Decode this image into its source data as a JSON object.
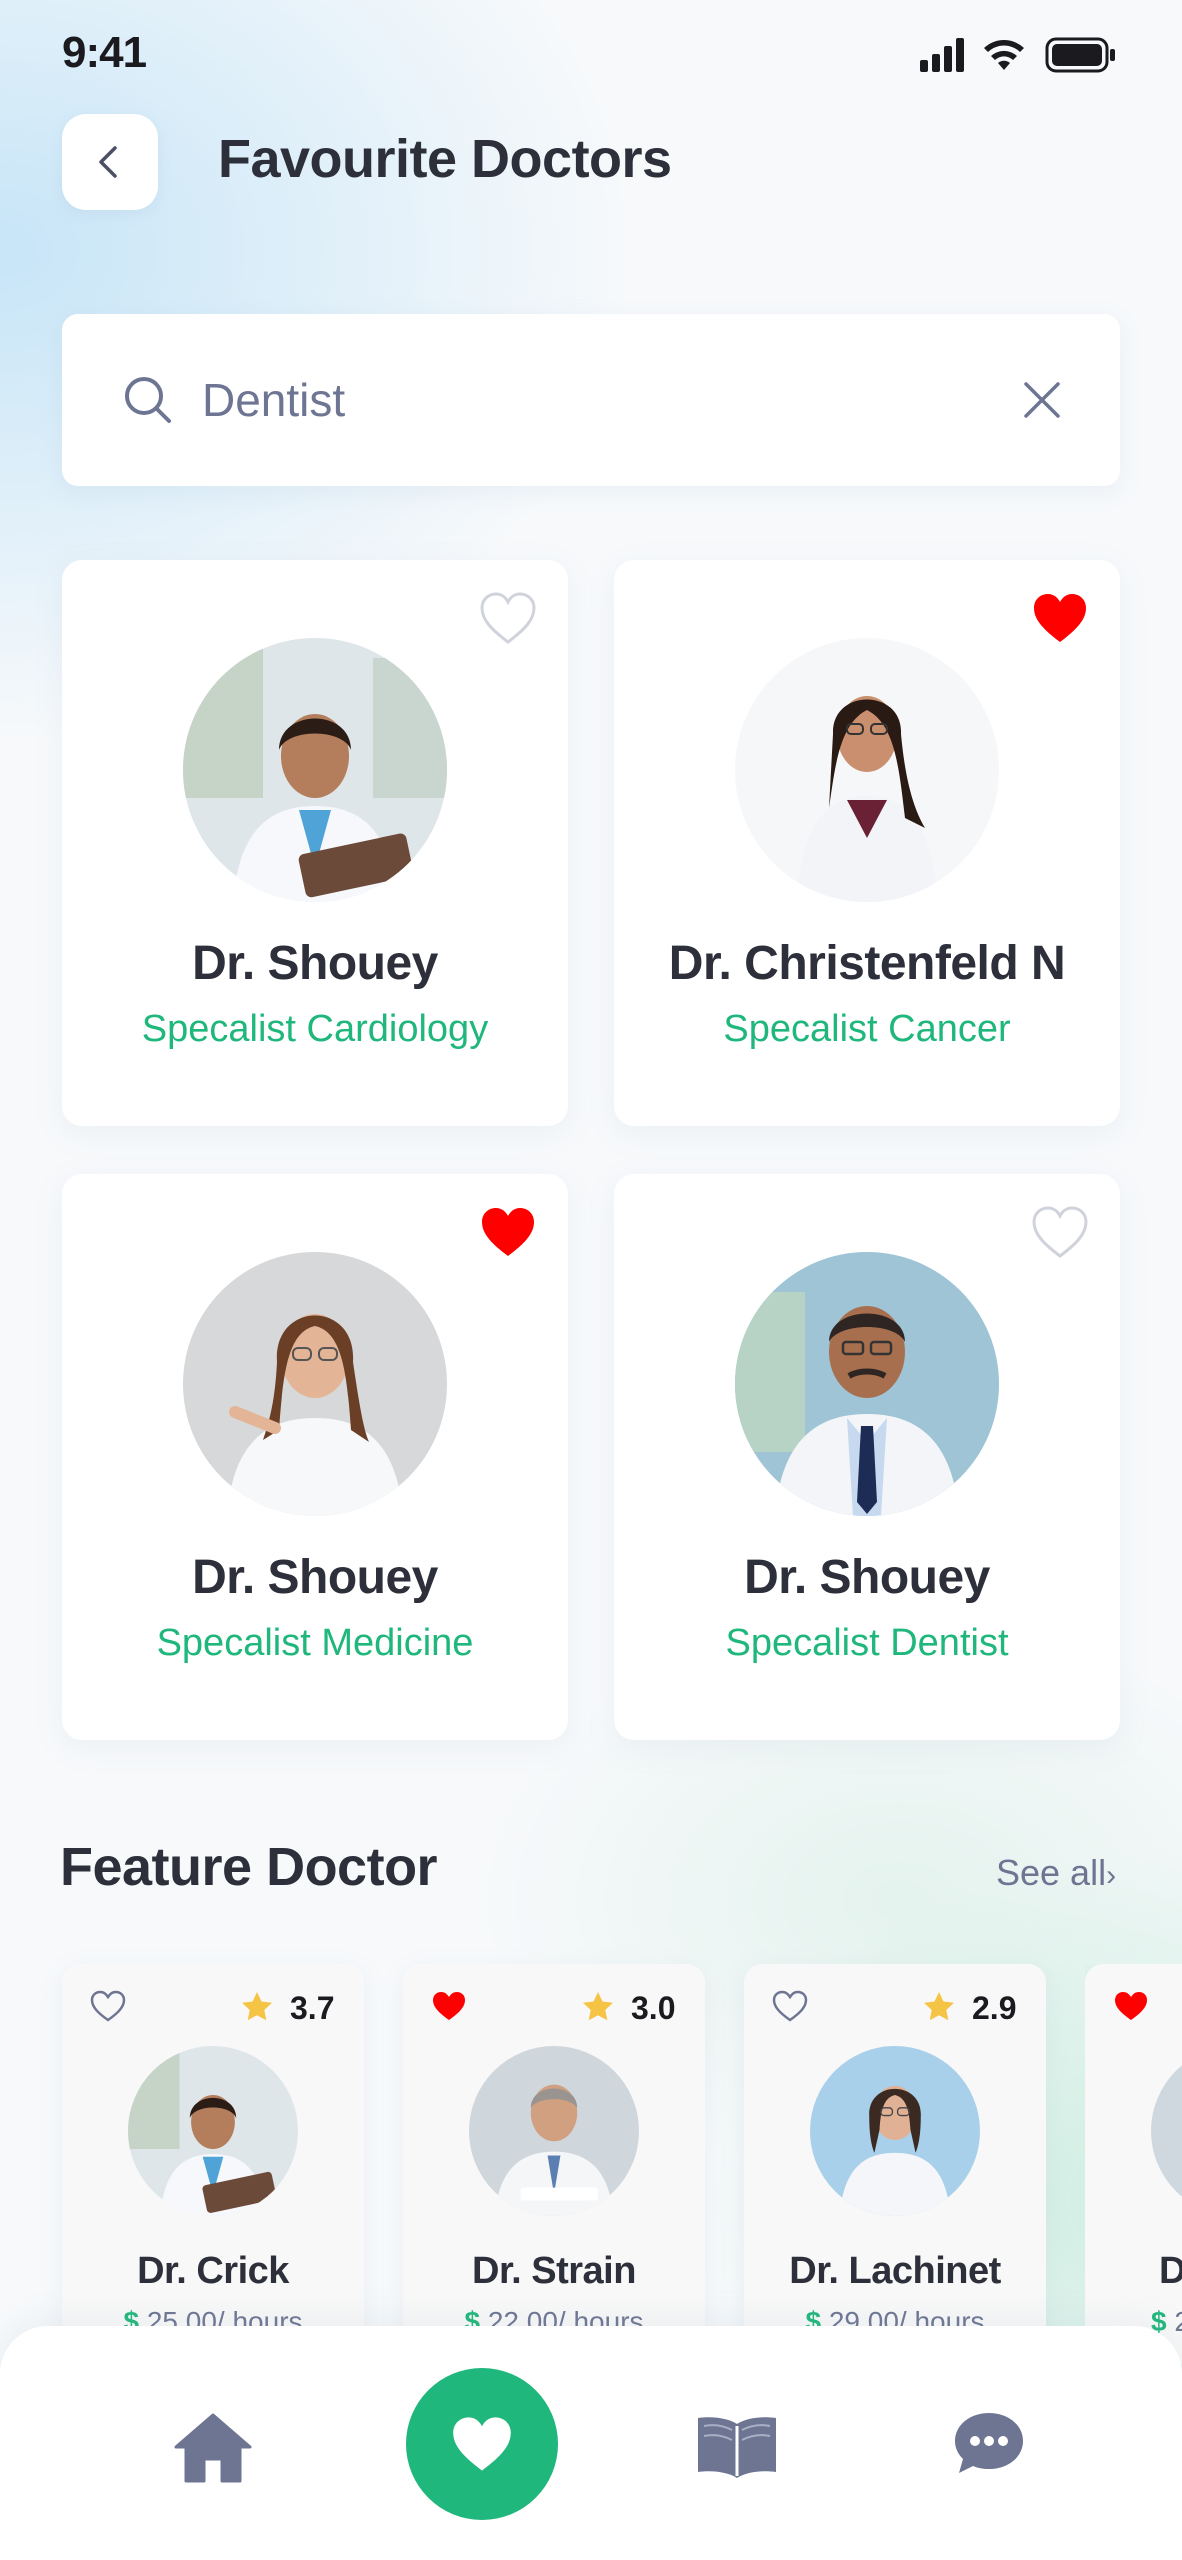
{
  "status_bar": {
    "time": "9:41",
    "icons": [
      "signal-icon",
      "wifi-icon",
      "battery-icon"
    ]
  },
  "header": {
    "back_icon": "chevron-left-icon",
    "title": "Favourite Doctors"
  },
  "search": {
    "value": "Dentist",
    "icon": "search-icon",
    "clear_icon": "close-icon"
  },
  "favourites": [
    {
      "name": "Dr. Shouey",
      "specialty": "Specalist Cardiology",
      "favourited": false
    },
    {
      "name": "Dr. Christenfeld N",
      "specialty": "Specalist Cancer",
      "favourited": true
    },
    {
      "name": "Dr. Shouey",
      "specialty": "Specalist Medicine",
      "favourited": true
    },
    {
      "name": "Dr. Shouey",
      "specialty": "Specalist Dentist",
      "favourited": false
    }
  ],
  "feature": {
    "title": "Feature Doctor",
    "see_all": "See all",
    "doctors": [
      {
        "name": "Dr. Crick",
        "rating": "3.7",
        "currency": "$",
        "price": "25.00/ hours",
        "favourited": false
      },
      {
        "name": "Dr. Strain",
        "rating": "3.0",
        "currency": "$",
        "price": "22.00/ hours",
        "favourited": true
      },
      {
        "name": "Dr. Lachinet",
        "rating": "2.9",
        "currency": "$",
        "price": "29.00/ hours",
        "favourited": false
      },
      {
        "name": "D",
        "rating": "",
        "currency": "$",
        "price": "2",
        "favourited": true
      }
    ]
  },
  "bottom_nav": {
    "items": [
      "home-icon",
      "heart-icon",
      "book-icon",
      "chat-icon"
    ],
    "active": "heart-icon"
  },
  "colors": {
    "accent": "#1fb77b",
    "heart_active": "#ff0000",
    "title_text": "#2d2f3a",
    "muted_text": "#6d7593",
    "nav_icon": "#6d7593"
  }
}
